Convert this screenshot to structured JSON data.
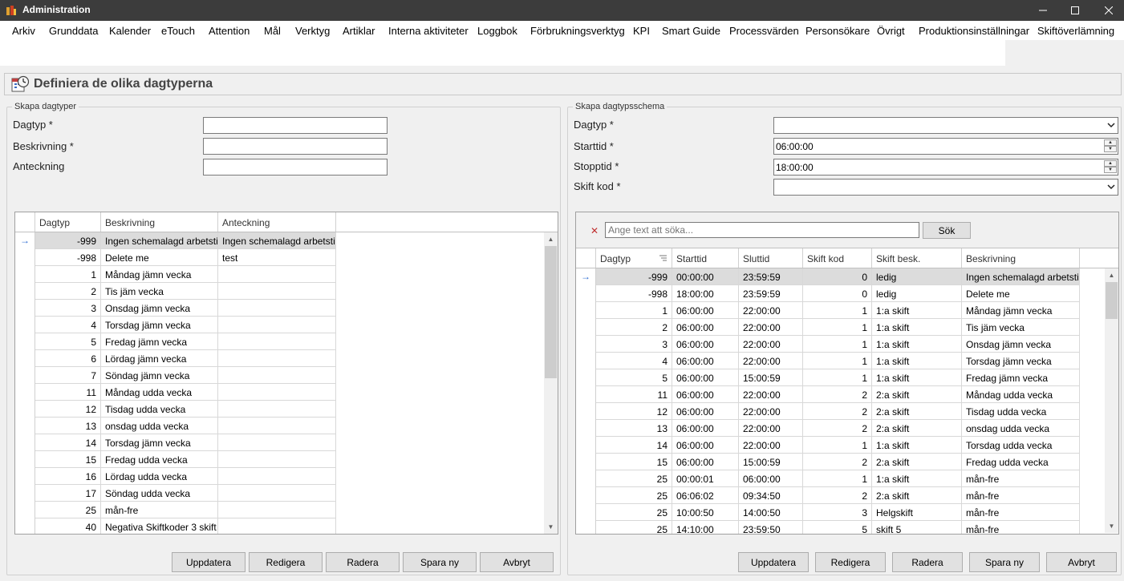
{
  "window": {
    "title": "Administration"
  },
  "menu": [
    "Arkiv",
    "Grunddata",
    "Kalender",
    "eTouch",
    "Attention",
    "Mål",
    "Verktyg",
    "Artiklar",
    "Interna aktiviteter",
    "Loggbok",
    "Förbrukningsverktyg",
    "KPI",
    "Smart Guide",
    "Processvärden",
    "Personsökare",
    "Övrigt",
    "Produktionsinställningar",
    "Skiftöverlämning"
  ],
  "page": {
    "title": "Definiera de olika dagtyperna"
  },
  "left": {
    "legend": "Skapa dagtyper",
    "labels": {
      "dagtyp": "Dagtyp *",
      "beskrivning": "Beskrivning *",
      "anteckning": "Anteckning"
    },
    "values": {
      "dagtyp": "",
      "beskrivning": "",
      "anteckning": ""
    },
    "columns": [
      "Dagtyp",
      "Beskrivning",
      "Anteckning"
    ],
    "rows": [
      [
        "-999",
        "Ingen schemalagd arbetstid",
        "Ingen schemalagd arbetstid"
      ],
      [
        "-998",
        "Delete me",
        "test"
      ],
      [
        "1",
        "Måndag jämn vecka",
        ""
      ],
      [
        "2",
        "Tis jäm vecka",
        ""
      ],
      [
        "3",
        "Onsdag jämn vecka",
        ""
      ],
      [
        "4",
        "Torsdag jämn vecka",
        ""
      ],
      [
        "5",
        "Fredag jämn vecka",
        ""
      ],
      [
        "6",
        "Lördag jämn vecka",
        ""
      ],
      [
        "7",
        "Söndag jämn vecka",
        ""
      ],
      [
        "11",
        "Måndag udda vecka",
        ""
      ],
      [
        "12",
        "Tisdag udda vecka",
        ""
      ],
      [
        "13",
        "onsdag udda vecka",
        ""
      ],
      [
        "14",
        "Torsdag jämn vecka",
        ""
      ],
      [
        "15",
        "Fredag udda vecka",
        ""
      ],
      [
        "16",
        "Lördag udda vecka",
        ""
      ],
      [
        "17",
        "Söndag udda vecka",
        ""
      ],
      [
        "25",
        "mån-fre",
        ""
      ],
      [
        "40",
        "Negativa Skiftkoder 3 skift",
        ""
      ]
    ],
    "buttons": [
      "Uppdatera",
      "Redigera",
      "Radera",
      "Spara ny",
      "Avbryt"
    ]
  },
  "right": {
    "legend": "Skapa dagtypsschema",
    "labels": {
      "dagtyp": "Dagtyp *",
      "starttid": "Starttid *",
      "stopptid": "Stopptid *",
      "skiftkod": "Skift kod *"
    },
    "values": {
      "dagtyp": "",
      "starttid": "06:00:00",
      "stopptid": "18:00:00",
      "skiftkod": ""
    },
    "search": {
      "placeholder": "Ange text att söka...",
      "button": "Sök"
    },
    "columns": [
      "Dagtyp",
      "Starttid",
      "Sluttid",
      "Skift kod",
      "Skift besk.",
      "Beskrivning"
    ],
    "rows": [
      [
        "-999",
        "00:00:00",
        "23:59:59",
        "0",
        "ledig",
        "Ingen schemalagd arbetstid"
      ],
      [
        "-998",
        "18:00:00",
        "23:59:59",
        "0",
        "ledig",
        "Delete me"
      ],
      [
        "1",
        "06:00:00",
        "22:00:00",
        "1",
        "1:a skift",
        "Måndag jämn vecka"
      ],
      [
        "2",
        "06:00:00",
        "22:00:00",
        "1",
        "1:a skift",
        "Tis jäm vecka"
      ],
      [
        "3",
        "06:00:00",
        "22:00:00",
        "1",
        "1:a skift",
        "Onsdag jämn vecka"
      ],
      [
        "4",
        "06:00:00",
        "22:00:00",
        "1",
        "1:a skift",
        "Torsdag jämn vecka"
      ],
      [
        "5",
        "06:00:00",
        "15:00:59",
        "1",
        "1:a skift",
        "Fredag jämn vecka"
      ],
      [
        "11",
        "06:00:00",
        "22:00:00",
        "2",
        "2:a skift",
        "Måndag udda vecka"
      ],
      [
        "12",
        "06:00:00",
        "22:00:00",
        "2",
        "2:a skift",
        "Tisdag udda vecka"
      ],
      [
        "13",
        "06:00:00",
        "22:00:00",
        "2",
        "2:a skift",
        "onsdag udda vecka"
      ],
      [
        "14",
        "06:00:00",
        "22:00:00",
        "1",
        "1:a skift",
        "Torsdag udda vecka"
      ],
      [
        "15",
        "06:00:00",
        "15:00:59",
        "2",
        "2:a skift",
        "Fredag udda vecka"
      ],
      [
        "25",
        "00:00:01",
        "06:00:00",
        "1",
        "1:a skift",
        "mån-fre"
      ],
      [
        "25",
        "06:06:02",
        "09:34:50",
        "2",
        "2:a skift",
        "mån-fre"
      ],
      [
        "25",
        "10:00:50",
        "14:00:50",
        "3",
        "Helgskift",
        "mån-fre"
      ],
      [
        "25",
        "14:10:00",
        "23:59:50",
        "5",
        "skift  5",
        "mån-fre"
      ]
    ],
    "buttons": [
      "Uppdatera",
      "Redigera",
      "Radera",
      "Spara ny",
      "Avbryt"
    ]
  }
}
